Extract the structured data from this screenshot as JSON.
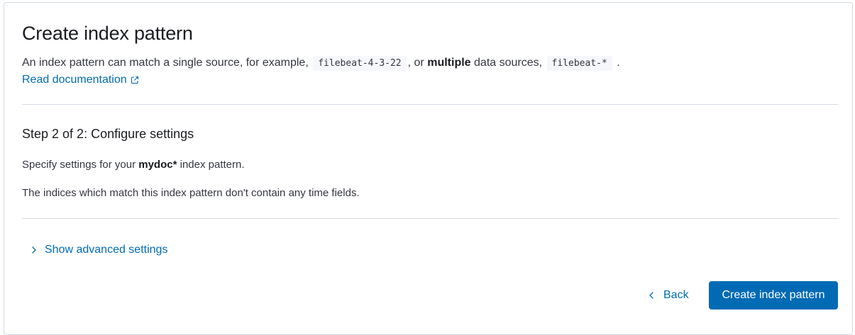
{
  "header": {
    "title": "Create index pattern",
    "intro_prefix": "An index pattern can match a single source, for example,",
    "example_single": "filebeat-4-3-22",
    "intro_mid": ", or",
    "intro_bold": "multiple",
    "intro_mid2": "data sources,",
    "example_multi": "filebeat-*",
    "intro_suffix": ".",
    "doc_link_label": "Read documentation",
    "doc_link_icon": "external-link-icon"
  },
  "step": {
    "title": "Step 2 of 2: Configure settings",
    "specify_prefix": "Specify settings for your",
    "pattern_name": "mydoc*",
    "specify_suffix": "index pattern.",
    "no_time_fields": "The indices which match this index pattern don't contain any time fields."
  },
  "advanced": {
    "toggle_label": "Show advanced settings",
    "toggle_icon": "chevron-right-icon"
  },
  "footer": {
    "back_label": "Back",
    "back_icon": "chevron-left-icon",
    "create_label": "Create index pattern"
  },
  "colors": {
    "accent": "#006bb4",
    "border": "#d3dae6",
    "text": "#343741",
    "heading": "#1a1c21",
    "code_bg": "#f5f7fa"
  }
}
